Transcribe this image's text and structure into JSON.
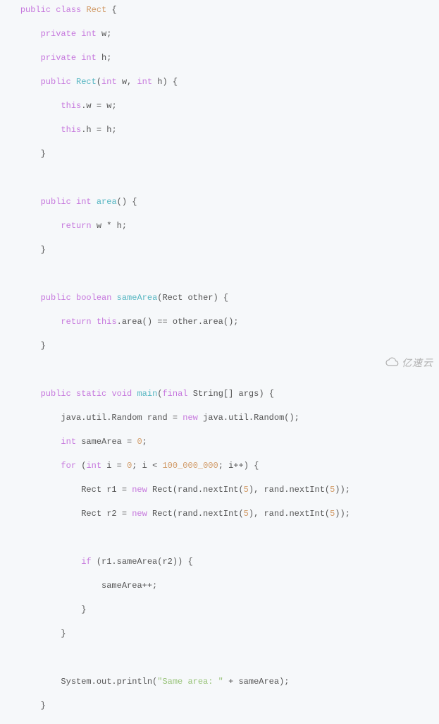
{
  "code": {
    "l1": {
      "kw1": "public",
      "kw2": "class",
      "cls": "Rect",
      "br": " {"
    },
    "l2": {
      "kw1": "private",
      "kw2": "int",
      "txt": " w;"
    },
    "l3": {
      "kw1": "private",
      "kw2": "int",
      "txt": " h;"
    },
    "l4": {
      "kw1": "public",
      "fn": "Rect",
      "params": "(int w, int h) {",
      "kw2": "int",
      "kw3": "int"
    },
    "l5": {
      "txt1": "this",
      "txt2": ".w = w;"
    },
    "l6": {
      "txt1": "this",
      "txt2": ".h = h;"
    },
    "l7": {
      "br": "}"
    },
    "l8": {
      "kw1": "public",
      "kw2": "int",
      "fn": "area",
      "rest": "() {"
    },
    "l9": {
      "kw": "return",
      "txt": " w * h;"
    },
    "l10": {
      "br": "}"
    },
    "l11": {
      "kw1": "public",
      "kw2": "boolean",
      "fn": "sameArea",
      "rest": "(Rect other) {"
    },
    "l12": {
      "kw": "return",
      "txt1": " ",
      "txt2": "this",
      "txt3": ".area() == other.area();"
    },
    "l13": {
      "br": "}"
    },
    "l14": {
      "kw1": "public",
      "kw2": "static",
      "kw3": "void",
      "fn": "main",
      "rest1": "(",
      "kw4": "final",
      "rest2": " String[] args) {"
    },
    "l15": {
      "txt1": "java.util.Random rand = ",
      "kw": "new",
      "txt2": " java.util.Random();"
    },
    "l16": {
      "kw": "int",
      "txt1": " sameArea = ",
      "num": "0",
      "txt2": ";"
    },
    "l17": {
      "kw1": "for",
      "txt1": " (",
      "kw2": "int",
      "txt2": " i = ",
      "num1": "0",
      "txt3": "; i < ",
      "num2": "100_000_000",
      "txt4": "; i++) {"
    },
    "l18": {
      "txt1": "Rect r1 = ",
      "kw": "new",
      "txt2": " Rect(rand.nextInt(",
      "num1": "5",
      "txt3": "), rand.nextInt(",
      "num2": "5",
      "txt4": "));"
    },
    "l19": {
      "txt1": "Rect r2 = ",
      "kw": "new",
      "txt2": " Rect(rand.nextInt(",
      "num1": "5",
      "txt3": "), rand.nextInt(",
      "num2": "5",
      "txt4": "));"
    },
    "l20": {
      "kw": "if",
      "txt": " (r1.sameArea(r2)) {"
    },
    "l21": {
      "txt": "sameArea++;"
    },
    "l22": {
      "br": "}"
    },
    "l23": {
      "br": "}"
    },
    "l24": {
      "txt1": "System.out.println(",
      "str": "\"Same area: \"",
      "txt2": " + sameArea);"
    },
    "l25": {
      "br": "}"
    }
  },
  "watermark": "亿速云"
}
